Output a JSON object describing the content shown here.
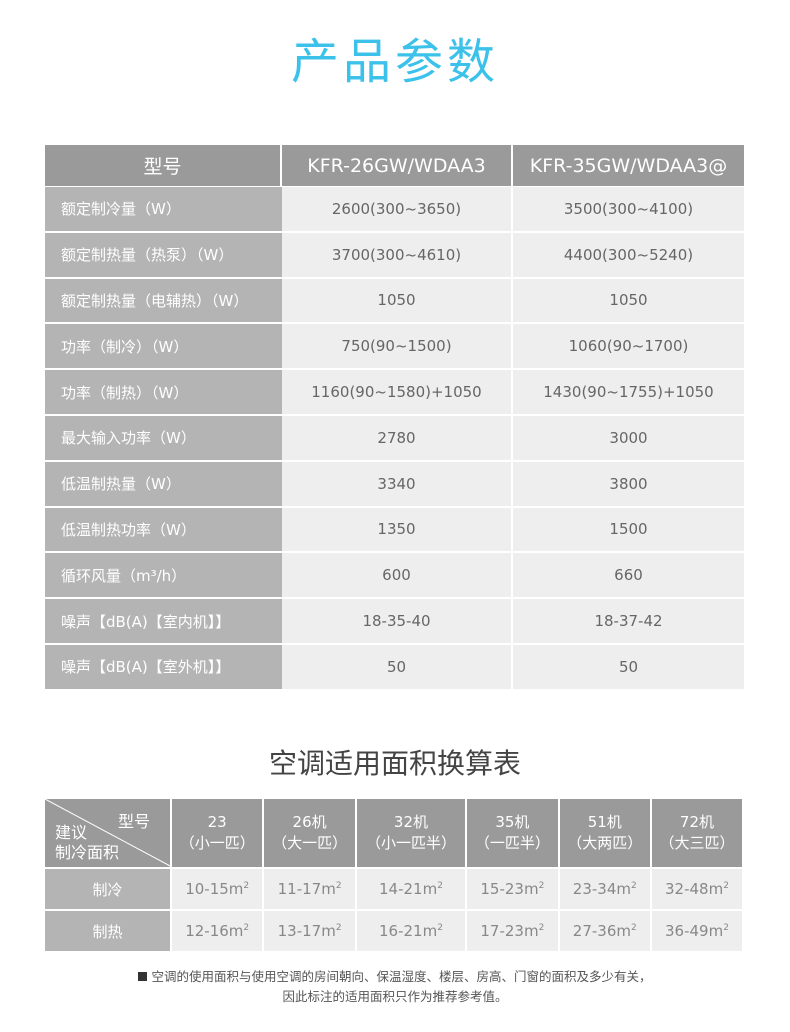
{
  "title": "产品参数",
  "spec_table": {
    "header": [
      "型号",
      "KFR-26GW/WDAA3",
      "KFR-35GW/WDAA3@"
    ],
    "rows": [
      {
        "label": "额定制冷量（W）",
        "a": "2600(300~3650)",
        "b": "3500(300~4100)"
      },
      {
        "label": "额定制热量（热泵）（W）",
        "a": "3700(300~4610)",
        "b": "4400(300~5240)"
      },
      {
        "label": "额定制热量（电辅热）（W）",
        "a": "1050",
        "b": "1050"
      },
      {
        "label": "功率（制冷）（W）",
        "a": "750(90~1500)",
        "b": "1060(90~1700)"
      },
      {
        "label": "功率（制热）（W）",
        "a": "1160(90~1580)+1050",
        "b": "1430(90~1755)+1050"
      },
      {
        "label": "最大输入功率（W）",
        "a": "2780",
        "b": "3000"
      },
      {
        "label": "低温制热量（W）",
        "a": "3340",
        "b": "3800"
      },
      {
        "label": "低温制热功率（W）",
        "a": "1350",
        "b": "1500"
      },
      {
        "label": "循环风量（m³/h）",
        "a": "600",
        "b": "660"
      },
      {
        "label": "噪声【dB(A)【室内机】】",
        "a": "18-35-40",
        "b": "18-37-42"
      },
      {
        "label": "噪声【dB(A)【室外机】】",
        "a": "50",
        "b": "50"
      }
    ]
  },
  "area_title": "空调适用面积换算表",
  "area_table": {
    "corner_top": "型号",
    "corner_bottom": [
      "建议",
      "制冷面积"
    ],
    "columns": [
      {
        "num": "23",
        "sub": "（小一匹）"
      },
      {
        "num": "26机",
        "sub": "（大一匹）"
      },
      {
        "num": "32机",
        "sub": "（小一匹半）"
      },
      {
        "num": "35机",
        "sub": "（一匹半）"
      },
      {
        "num": "51机",
        "sub": "（大两匹）"
      },
      {
        "num": "72机",
        "sub": "（大三匹）"
      }
    ],
    "unit": "m",
    "unit_sup": "2",
    "rows": [
      {
        "label": "制冷",
        "values": [
          "10-15m",
          "11-17m",
          "14-21m",
          "15-23m",
          "23-34m",
          "32-48m"
        ]
      },
      {
        "label": "制热",
        "values": [
          "12-16m",
          "13-17m",
          "16-21m",
          "17-23m",
          "27-36m",
          "36-49m"
        ]
      }
    ]
  },
  "note": {
    "line1": "空调的使用面积与使用空调的房间朝向、保温湿度、楼层、房高、门窗的面积及多少有关，",
    "line2": "因此标注的适用面积只作为推荐参考值。"
  }
}
